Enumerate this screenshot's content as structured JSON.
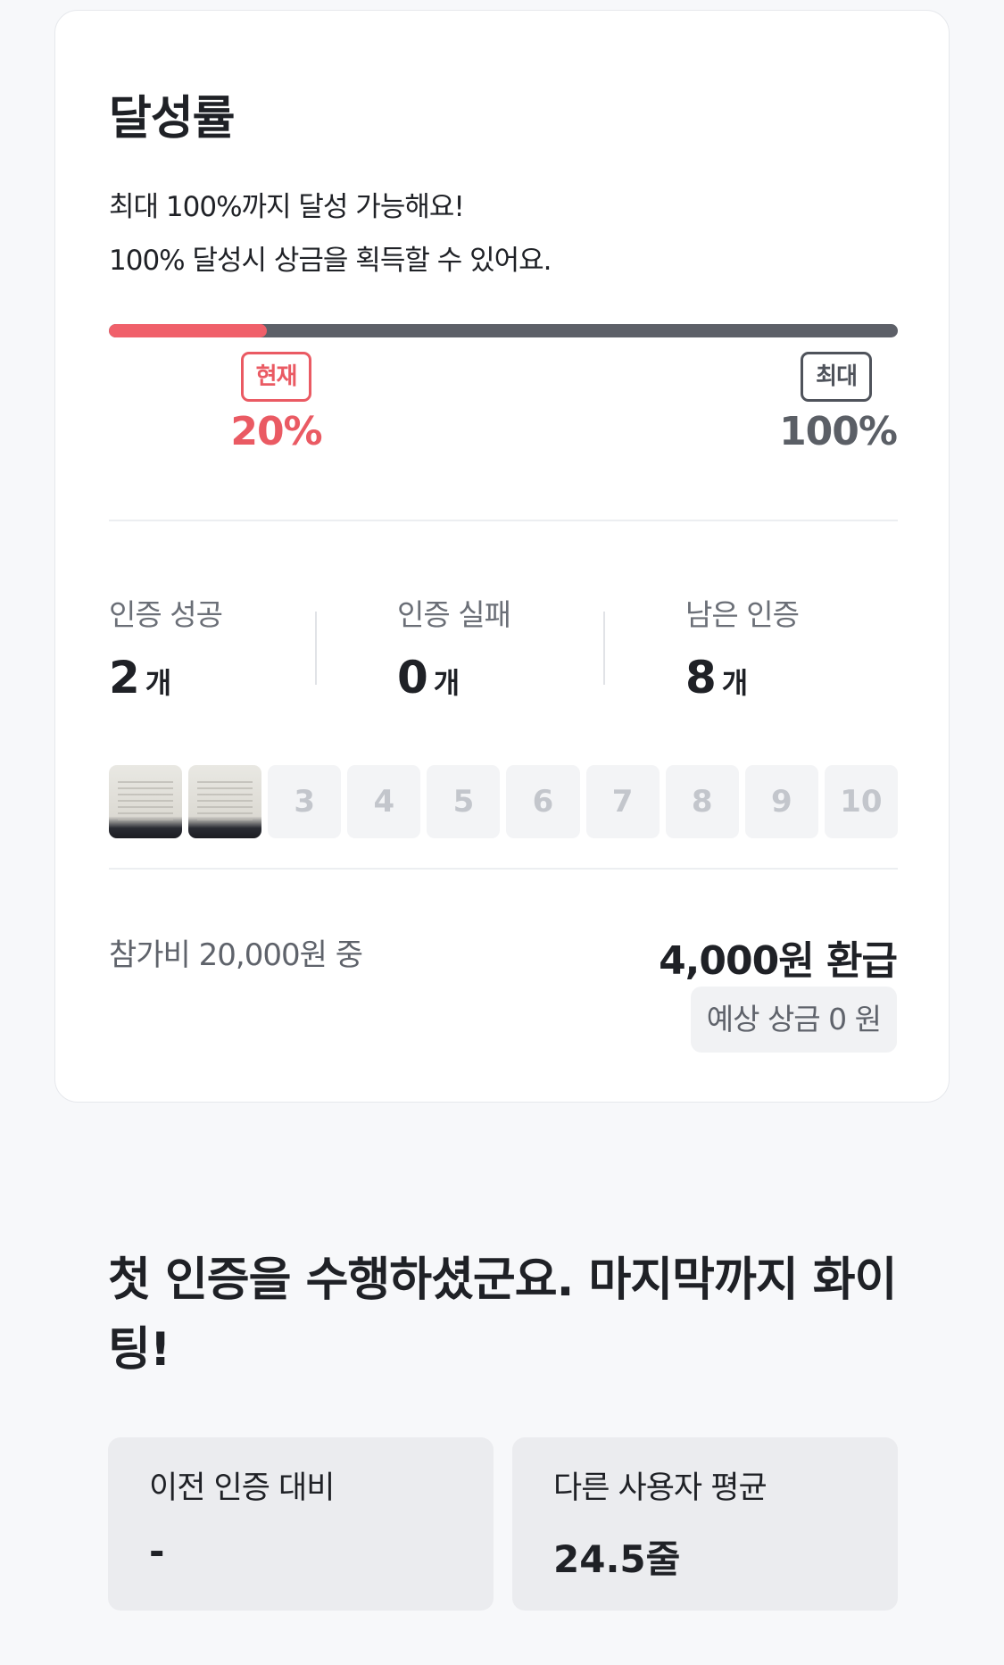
{
  "achievement": {
    "title": "달성률",
    "description_line1": "최대 100%까지 달성 가능해요!",
    "description_line2": "100% 달성시 상금을 획득할 수 있어요.",
    "progress_percent": 20,
    "current_tag": "현재",
    "current_value": "20%",
    "max_tag": "최대",
    "max_value": "100%",
    "colors": {
      "accent": "#f0606a",
      "track": "#5d6068"
    }
  },
  "stats": [
    {
      "label": "인증 성공",
      "value": "2",
      "unit": "개"
    },
    {
      "label": "인증 실패",
      "value": "0",
      "unit": "개"
    },
    {
      "label": "남은 인증",
      "value": "8",
      "unit": "개"
    }
  ],
  "slots": [
    {
      "label": "",
      "state": "photo"
    },
    {
      "label": "",
      "state": "photo"
    },
    {
      "label": "3",
      "state": "empty"
    },
    {
      "label": "4",
      "state": "empty"
    },
    {
      "label": "5",
      "state": "empty"
    },
    {
      "label": "6",
      "state": "empty"
    },
    {
      "label": "7",
      "state": "empty"
    },
    {
      "label": "8",
      "state": "empty"
    },
    {
      "label": "9",
      "state": "empty"
    },
    {
      "label": "10",
      "state": "empty"
    }
  ],
  "fee": {
    "label": "참가비 20,000원 중",
    "refund": "4,000원 환급",
    "expected_prize": "예상 상금 0 원"
  },
  "message": {
    "text": "첫 인증을 수행하셨군요. 마지막까지 화이팅!"
  },
  "comparison": [
    {
      "label": "이전 인증 대비",
      "value": "-"
    },
    {
      "label": "다른 사용자 평균",
      "value": "24.5줄"
    }
  ]
}
